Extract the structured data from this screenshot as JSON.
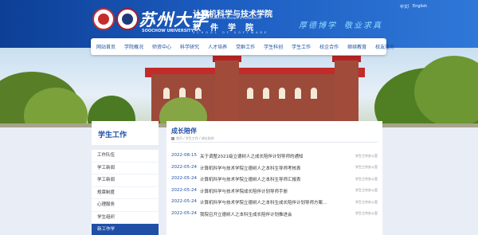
{
  "header": {
    "university_cn": "苏州大学",
    "university_en": "SOOCHOW UNIVERSITY",
    "college_cn": "计算机科学与技术学院",
    "college_en": "SCHOOL OF COMPUTER SCIENCE & TECHNOLOGY",
    "software_cn": "软件学院",
    "software_en": "SCHOOL OF SOFTWARE",
    "lang_cn": "中文",
    "lang_sep": "|",
    "lang_en": "English",
    "motto_1": "厚德博学",
    "motto_2": "敬业求真"
  },
  "nav": {
    "items": [
      "网站首页",
      "学院概况",
      "师资中心",
      "科学研究",
      "人才培养",
      "党群工作",
      "学生科创",
      "学生工作",
      "校企合作",
      "继续教育",
      "校友服务"
    ]
  },
  "sidebar": {
    "title": "学生工作",
    "items": [
      "工作队伍",
      "学工新闻",
      "学工新闻",
      "规章制度",
      "心理服务",
      "学生组织",
      "新工作学"
    ],
    "active_index": 6
  },
  "main": {
    "title": "成长陪伴",
    "breadcrumb": "首页 / 学生工作 / 成长陪伴",
    "news": [
      {
        "date": "2022-08-15",
        "title": "关于调整2021级立德树人之成长陪伴计划导师的通知",
        "category": "学生工作办公室"
      },
      {
        "date": "2022-05-24",
        "title": "计算机科学与技术学院立德树人之本科生导师考核表",
        "category": "学生工作办公室"
      },
      {
        "date": "2022-05-24",
        "title": "计算机科学与技术学院立德树人之本科生导师汇报表",
        "category": "学生工作办公室"
      },
      {
        "date": "2022-05-24",
        "title": "计算机科学与技术学院成长陪伴计划导师手册",
        "category": "学生工作办公室"
      },
      {
        "date": "2022-05-24",
        "title": "计算机科学与技术学院立德树人之本科生成长陪伴计划导师方案（试…",
        "category": "学生工作办公室"
      },
      {
        "date": "2022-05-24",
        "title": "我院召开立德树人之本科生成长陪伴计划推进会",
        "category": "学生工作办公室"
      }
    ]
  },
  "colors": {
    "brand_blue": "#1f4fa6",
    "header_gradient_start": "#0d3f95",
    "header_gradient_end": "#2f78d8",
    "motto": "#8fd9ff"
  }
}
